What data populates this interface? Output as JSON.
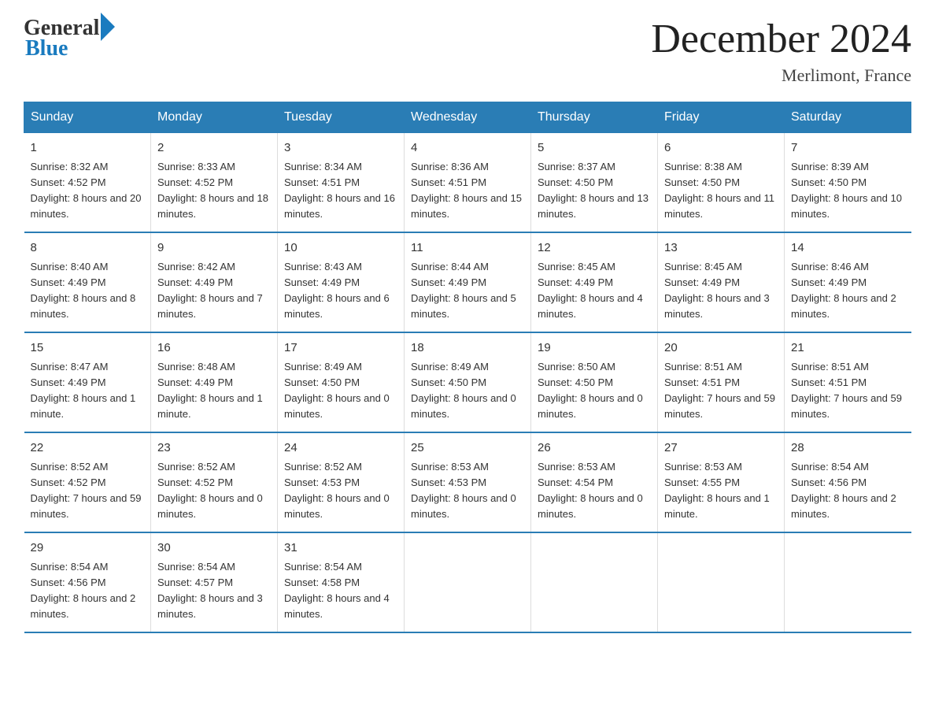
{
  "logo": {
    "general": "General",
    "blue": "Blue"
  },
  "title": "December 2024",
  "location": "Merlimont, France",
  "days_of_week": [
    "Sunday",
    "Monday",
    "Tuesday",
    "Wednesday",
    "Thursday",
    "Friday",
    "Saturday"
  ],
  "weeks": [
    [
      {
        "day": "1",
        "sunrise": "8:32 AM",
        "sunset": "4:52 PM",
        "daylight": "8 hours and 20 minutes."
      },
      {
        "day": "2",
        "sunrise": "8:33 AM",
        "sunset": "4:52 PM",
        "daylight": "8 hours and 18 minutes."
      },
      {
        "day": "3",
        "sunrise": "8:34 AM",
        "sunset": "4:51 PM",
        "daylight": "8 hours and 16 minutes."
      },
      {
        "day": "4",
        "sunrise": "8:36 AM",
        "sunset": "4:51 PM",
        "daylight": "8 hours and 15 minutes."
      },
      {
        "day": "5",
        "sunrise": "8:37 AM",
        "sunset": "4:50 PM",
        "daylight": "8 hours and 13 minutes."
      },
      {
        "day": "6",
        "sunrise": "8:38 AM",
        "sunset": "4:50 PM",
        "daylight": "8 hours and 11 minutes."
      },
      {
        "day": "7",
        "sunrise": "8:39 AM",
        "sunset": "4:50 PM",
        "daylight": "8 hours and 10 minutes."
      }
    ],
    [
      {
        "day": "8",
        "sunrise": "8:40 AM",
        "sunset": "4:49 PM",
        "daylight": "8 hours and 8 minutes."
      },
      {
        "day": "9",
        "sunrise": "8:42 AM",
        "sunset": "4:49 PM",
        "daylight": "8 hours and 7 minutes."
      },
      {
        "day": "10",
        "sunrise": "8:43 AM",
        "sunset": "4:49 PM",
        "daylight": "8 hours and 6 minutes."
      },
      {
        "day": "11",
        "sunrise": "8:44 AM",
        "sunset": "4:49 PM",
        "daylight": "8 hours and 5 minutes."
      },
      {
        "day": "12",
        "sunrise": "8:45 AM",
        "sunset": "4:49 PM",
        "daylight": "8 hours and 4 minutes."
      },
      {
        "day": "13",
        "sunrise": "8:45 AM",
        "sunset": "4:49 PM",
        "daylight": "8 hours and 3 minutes."
      },
      {
        "day": "14",
        "sunrise": "8:46 AM",
        "sunset": "4:49 PM",
        "daylight": "8 hours and 2 minutes."
      }
    ],
    [
      {
        "day": "15",
        "sunrise": "8:47 AM",
        "sunset": "4:49 PM",
        "daylight": "8 hours and 1 minute."
      },
      {
        "day": "16",
        "sunrise": "8:48 AM",
        "sunset": "4:49 PM",
        "daylight": "8 hours and 1 minute."
      },
      {
        "day": "17",
        "sunrise": "8:49 AM",
        "sunset": "4:50 PM",
        "daylight": "8 hours and 0 minutes."
      },
      {
        "day": "18",
        "sunrise": "8:49 AM",
        "sunset": "4:50 PM",
        "daylight": "8 hours and 0 minutes."
      },
      {
        "day": "19",
        "sunrise": "8:50 AM",
        "sunset": "4:50 PM",
        "daylight": "8 hours and 0 minutes."
      },
      {
        "day": "20",
        "sunrise": "8:51 AM",
        "sunset": "4:51 PM",
        "daylight": "7 hours and 59 minutes."
      },
      {
        "day": "21",
        "sunrise": "8:51 AM",
        "sunset": "4:51 PM",
        "daylight": "7 hours and 59 minutes."
      }
    ],
    [
      {
        "day": "22",
        "sunrise": "8:52 AM",
        "sunset": "4:52 PM",
        "daylight": "7 hours and 59 minutes."
      },
      {
        "day": "23",
        "sunrise": "8:52 AM",
        "sunset": "4:52 PM",
        "daylight": "8 hours and 0 minutes."
      },
      {
        "day": "24",
        "sunrise": "8:52 AM",
        "sunset": "4:53 PM",
        "daylight": "8 hours and 0 minutes."
      },
      {
        "day": "25",
        "sunrise": "8:53 AM",
        "sunset": "4:53 PM",
        "daylight": "8 hours and 0 minutes."
      },
      {
        "day": "26",
        "sunrise": "8:53 AM",
        "sunset": "4:54 PM",
        "daylight": "8 hours and 0 minutes."
      },
      {
        "day": "27",
        "sunrise": "8:53 AM",
        "sunset": "4:55 PM",
        "daylight": "8 hours and 1 minute."
      },
      {
        "day": "28",
        "sunrise": "8:54 AM",
        "sunset": "4:56 PM",
        "daylight": "8 hours and 2 minutes."
      }
    ],
    [
      {
        "day": "29",
        "sunrise": "8:54 AM",
        "sunset": "4:56 PM",
        "daylight": "8 hours and 2 minutes."
      },
      {
        "day": "30",
        "sunrise": "8:54 AM",
        "sunset": "4:57 PM",
        "daylight": "8 hours and 3 minutes."
      },
      {
        "day": "31",
        "sunrise": "8:54 AM",
        "sunset": "4:58 PM",
        "daylight": "8 hours and 4 minutes."
      },
      null,
      null,
      null,
      null
    ]
  ]
}
